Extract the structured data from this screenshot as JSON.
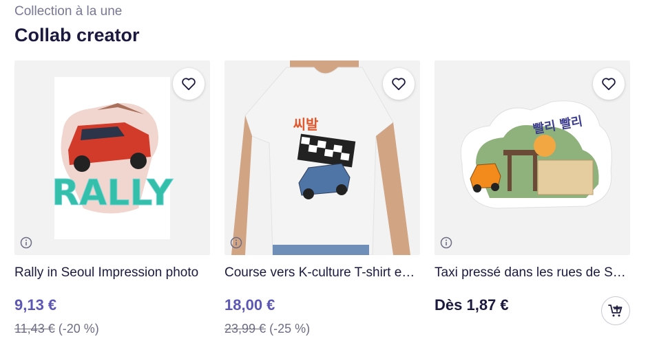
{
  "section": {
    "eyebrow": "Collection à la une",
    "title": "Collab creator"
  },
  "products": [
    {
      "name": "Rally in Seoul Impression photo",
      "price": "9,13 €",
      "old_price": "11,43 €",
      "discount": "(-20 %)",
      "artwork_text": "RALLY"
    },
    {
      "name": "Course vers K-culture T-shirt essentiel",
      "price": "18,00 €",
      "old_price": "23,99 €",
      "discount": "(-25 %)",
      "artwork_text": "씨발"
    },
    {
      "name": "Taxi pressé dans les rues de Séoul Sticker",
      "price": "Dès 1,87 €",
      "artwork_text": "빨리 빨리"
    }
  ],
  "icons": {
    "favorite": "heart-icon",
    "info": "info-icon",
    "cart": "add-to-cart-icon"
  },
  "colors": {
    "sale_price": "#5c56b5",
    "text": "#1b1a3e",
    "muted": "#787796"
  }
}
